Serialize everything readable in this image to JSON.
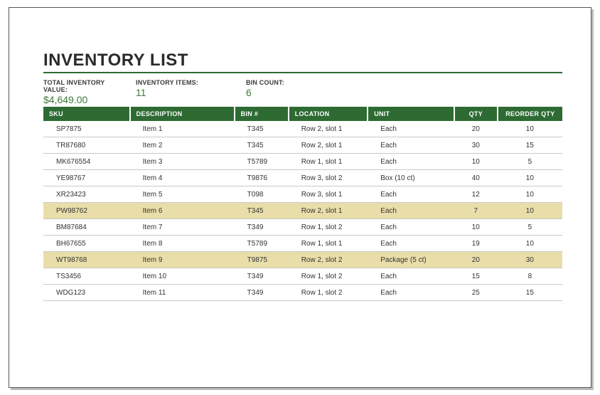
{
  "title": "INVENTORY LIST",
  "summary": {
    "total_label": "TOTAL INVENTORY VALUE:",
    "total_value": "$4,649.00",
    "items_label": "INVENTORY ITEMS:",
    "items_value": "11",
    "bins_label": "BIN COUNT:",
    "bins_value": "6"
  },
  "headers": {
    "sku": "SKU",
    "desc": "DESCRIPTION",
    "bin": "BIN #",
    "loc": "LOCATION",
    "unit": "UNIT",
    "qty": "QTY",
    "re": "REORDER QTY"
  },
  "rows": [
    {
      "sku": "SP7875",
      "desc": "Item 1",
      "bin": "T345",
      "loc": "Row 2, slot 1",
      "unit": "Each",
      "qty": "20",
      "re": "10",
      "hl": false
    },
    {
      "sku": "TR87680",
      "desc": "Item 2",
      "bin": "T345",
      "loc": "Row 2, slot 1",
      "unit": "Each",
      "qty": "30",
      "re": "15",
      "hl": false
    },
    {
      "sku": "MK676554",
      "desc": "Item 3",
      "bin": "T5789",
      "loc": "Row 1, slot 1",
      "unit": "Each",
      "qty": "10",
      "re": "5",
      "hl": false
    },
    {
      "sku": "YE98767",
      "desc": "Item 4",
      "bin": "T9876",
      "loc": "Row 3, slot 2",
      "unit": "Box (10 ct)",
      "qty": "40",
      "re": "10",
      "hl": false
    },
    {
      "sku": "XR23423",
      "desc": "Item 5",
      "bin": "T098",
      "loc": "Row 3, slot 1",
      "unit": "Each",
      "qty": "12",
      "re": "10",
      "hl": false
    },
    {
      "sku": "PW98762",
      "desc": "Item 6",
      "bin": "T345",
      "loc": "Row 2, slot 1",
      "unit": "Each",
      "qty": "7",
      "re": "10",
      "hl": true
    },
    {
      "sku": "BM87684",
      "desc": "Item 7",
      "bin": "T349",
      "loc": "Row 1, slot 2",
      "unit": "Each",
      "qty": "10",
      "re": "5",
      "hl": false
    },
    {
      "sku": "BH67655",
      "desc": "Item 8",
      "bin": "T5789",
      "loc": "Row 1, slot 1",
      "unit": "Each",
      "qty": "19",
      "re": "10",
      "hl": false
    },
    {
      "sku": "WT98768",
      "desc": "Item 9",
      "bin": "T9875",
      "loc": "Row 2, slot 2",
      "unit": "Package (5 ct)",
      "qty": "20",
      "re": "30",
      "hl": true
    },
    {
      "sku": "TS3456",
      "desc": "Item 10",
      "bin": "T349",
      "loc": "Row 1, slot 2",
      "unit": "Each",
      "qty": "15",
      "re": "8",
      "hl": false
    },
    {
      "sku": "WDG123",
      "desc": "Item 11",
      "bin": "T349",
      "loc": "Row 1, slot 2",
      "unit": "Each",
      "qty": "25",
      "re": "15",
      "hl": false
    }
  ],
  "chart_data": {
    "type": "table",
    "title": "INVENTORY LIST",
    "columns": [
      "SKU",
      "DESCRIPTION",
      "BIN #",
      "LOCATION",
      "UNIT",
      "QTY",
      "REORDER QTY"
    ],
    "summary": {
      "total_inventory_value": 4649.0,
      "inventory_items": 11,
      "bin_count": 6
    },
    "rows": [
      [
        "SP7875",
        "Item 1",
        "T345",
        "Row 2, slot 1",
        "Each",
        20,
        10
      ],
      [
        "TR87680",
        "Item 2",
        "T345",
        "Row 2, slot 1",
        "Each",
        30,
        15
      ],
      [
        "MK676554",
        "Item 3",
        "T5789",
        "Row 1, slot 1",
        "Each",
        10,
        5
      ],
      [
        "YE98767",
        "Item 4",
        "T9876",
        "Row 3, slot 2",
        "Box (10 ct)",
        40,
        10
      ],
      [
        "XR23423",
        "Item 5",
        "T098",
        "Row 3, slot 1",
        "Each",
        12,
        10
      ],
      [
        "PW98762",
        "Item 6",
        "T345",
        "Row 2, slot 1",
        "Each",
        7,
        10
      ],
      [
        "BM87684",
        "Item 7",
        "T349",
        "Row 1, slot 2",
        "Each",
        10,
        5
      ],
      [
        "BH67655",
        "Item 8",
        "T5789",
        "Row 1, slot 1",
        "Each",
        19,
        10
      ],
      [
        "WT98768",
        "Item 9",
        "T9875",
        "Row 2, slot 2",
        "Package (5 ct)",
        20,
        30
      ],
      [
        "TS3456",
        "Item 10",
        "T349",
        "Row 1, slot 2",
        "Each",
        15,
        8
      ],
      [
        "WDG123",
        "Item 11",
        "T349",
        "Row 1, slot 2",
        "Each",
        25,
        15
      ]
    ]
  }
}
